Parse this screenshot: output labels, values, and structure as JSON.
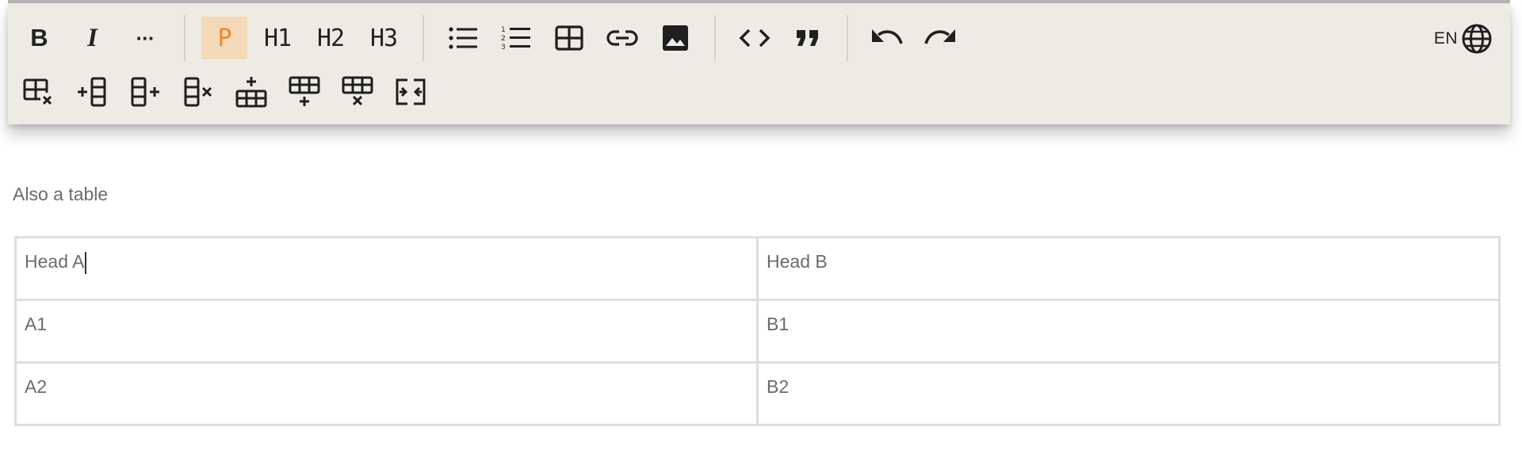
{
  "toolbar": {
    "bold_label": "B",
    "italic_label": "I",
    "more_label": "···",
    "paragraph_label": "P",
    "h1_label": "H1",
    "h2_label": "H2",
    "h3_label": "H3",
    "language_code": "EN",
    "active_color": "#ef8a2a",
    "active_bg": "#f3d9b8",
    "background": "#eeebe5",
    "icons_row1": [
      "bullet-list-icon",
      "numbered-list-icon",
      "table-icon",
      "link-icon",
      "image-icon",
      "code-icon",
      "quote-icon",
      "undo-icon",
      "redo-icon",
      "globe-icon"
    ],
    "icons_row2": [
      "delete-table-icon",
      "add-column-before-icon",
      "add-column-after-icon",
      "delete-column-icon",
      "add-row-before-icon",
      "add-row-after-icon",
      "delete-row-icon",
      "merge-cells-icon"
    ]
  },
  "content": {
    "paragraph": "Also a table",
    "table": {
      "rows": [
        [
          "Head A",
          "Head B"
        ],
        [
          "A1",
          "B1"
        ],
        [
          "A2",
          "B2"
        ]
      ]
    }
  }
}
